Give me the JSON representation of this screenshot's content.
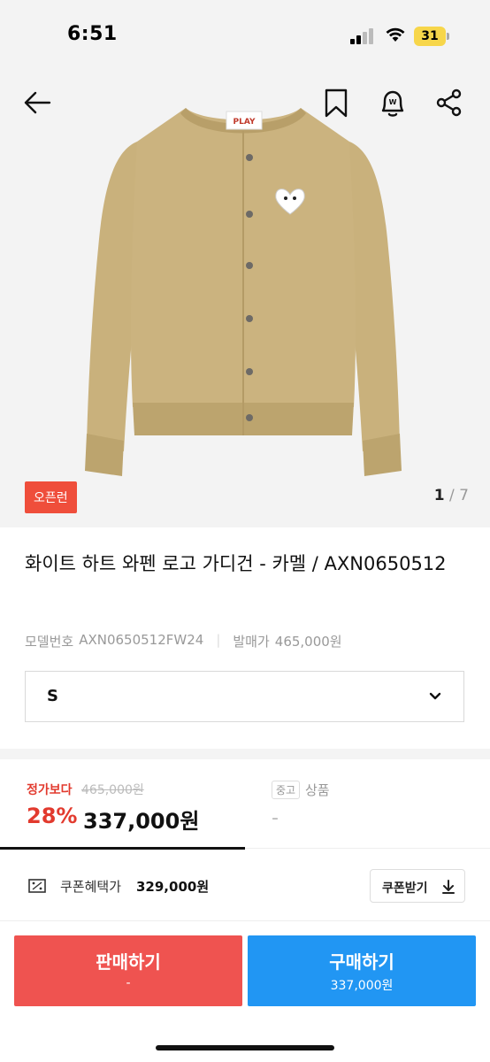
{
  "status_bar": {
    "time": "6:51",
    "battery": "31"
  },
  "hero": {
    "badge": "오픈런",
    "page_current": "1",
    "page_sep": " / ",
    "page_total": "7",
    "logo_text": "PLAY"
  },
  "product": {
    "title": "화이트 하트 와펜 로고 가디건 - 카멜 / AXN0650512",
    "model_label": "모델번호",
    "model_value": "AXN0650512FW24",
    "release_label": "발매가",
    "release_value": "465,000원"
  },
  "size_select": {
    "value": "S"
  },
  "price": {
    "below_label": "정가보다",
    "original_price": "465,000원",
    "discount": "28%",
    "sale_price": "337,000원",
    "used_tag": "중고",
    "used_label": "상품",
    "used_value": "-"
  },
  "coupon": {
    "label": "쿠폰혜택가",
    "price": "329,000원",
    "button_label": "쿠폰받기"
  },
  "actions": {
    "sell_label": "판매하기",
    "sell_sub": "-",
    "buy_label": "구매하기",
    "buy_sub": "337,000원"
  },
  "colors": {
    "sell": "#ef5350",
    "buy": "#2196f3",
    "accent_red": "#e23a2e",
    "badge": "#ef4e3b",
    "cardigan": "#c9b17c"
  },
  "icons": [
    "back-arrow-icon",
    "bookmark-icon",
    "price-alert-icon",
    "share-icon",
    "chevron-down-icon",
    "coupon-icon",
    "download-icon"
  ]
}
